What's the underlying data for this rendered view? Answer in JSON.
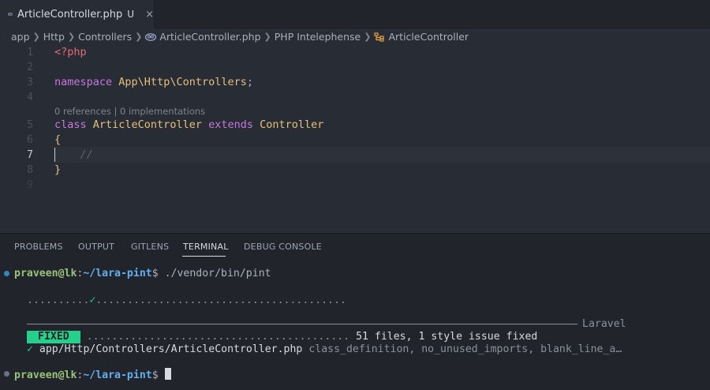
{
  "tab": {
    "file_name": "ArticleController.php",
    "status": "U",
    "close": "×",
    "icon": "php-elephant-icon"
  },
  "breadcrumb": {
    "items": [
      "app",
      "Http",
      "Controllers",
      "ArticleController.php",
      "PHP Intelephense",
      "ArticleController"
    ]
  },
  "editor": {
    "line_numbers": [
      "1",
      "2",
      "3",
      "4",
      "5",
      "6",
      "7",
      "8",
      "9"
    ],
    "active_line": "7",
    "codelens": "0 references | 0 implementations",
    "code": {
      "open_tag": "<?php",
      "namespace_kw": "namespace",
      "namespace_name": "App\\Http\\Controllers",
      "semicolon": ";",
      "class_kw": "class",
      "class_name": "ArticleController",
      "extends_kw": "extends",
      "parent_class": "Controller",
      "open_brace": "{",
      "comment": "//",
      "close_brace": "}"
    }
  },
  "panel": {
    "tabs": [
      "PROBLEMS",
      "OUTPUT",
      "GITLENS",
      "TERMINAL",
      "DEBUG CONSOLE"
    ],
    "active_tab": "TERMINAL"
  },
  "terminal": {
    "prompt_user": "praveen@lk",
    "prompt_colon": ":",
    "prompt_path": "~/lara-pint",
    "prompt_dollar": "$",
    "command": " ./vendor/bin/pint",
    "progress_pre": "..........",
    "progress_check": "✓",
    "progress_post": "........................................",
    "header_label": "Laravel",
    "fixed_badge": "FIXED",
    "summary_dots": "..........................................",
    "summary_text": "51 files, 1 style issue fixed",
    "file_check": "✓",
    "file_path": "app/Http/Controllers/ArticleController.php",
    "file_rules": "class_definition, no_unused_imports, blank_line_a…",
    "colors": {
      "prompt_dot_1": "#2e8bc0",
      "prompt_dot_2": "#6b7280",
      "success": "#23d18b"
    }
  }
}
